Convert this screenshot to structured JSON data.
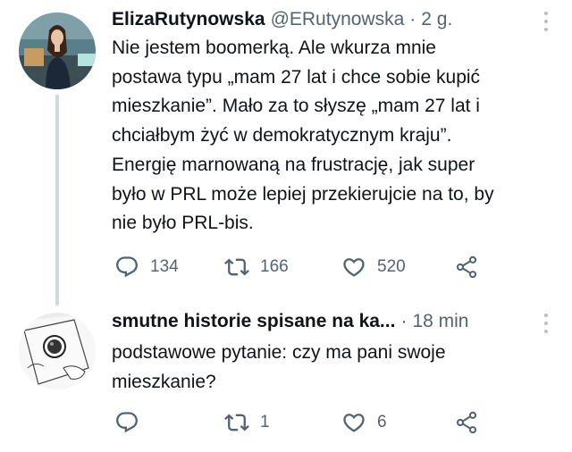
{
  "tweets": [
    {
      "author": "ElizaRutynowska",
      "handle": "@ERutynowska",
      "separator": "·",
      "time": "2 g.",
      "text": "Nie jestem boomerką. Ale wkurza mnie\npostawa typu „mam 27 lat i chce sobie kupić\nmieszkanie”. Mało za to słyszę „mam 27 lat i\nchciałbym żyć w demokratycznym kraju”.\nEnergię marnowaną na frustrację, jak super\nbyło w PRL może lepiej przekierujcie na to, by\nnie było PRL-bis.",
      "replies": "134",
      "retweets": "166",
      "likes": "520"
    },
    {
      "author": "smutne historie spisane na ka...",
      "separator": "·",
      "time": "18 min",
      "text": "podstawowe pytanie: czy ma pani swoje\nmieszkanie?",
      "replies": "",
      "retweets": "1",
      "likes": "6"
    }
  ],
  "icons": {
    "reply": "reply-icon",
    "retweet": "retweet-icon",
    "like": "heart-icon",
    "share": "share-icon",
    "more": "more-icon"
  },
  "colors": {
    "text": "#0f1419",
    "secondary": "#536471",
    "thread_line": "#cfd9de"
  }
}
